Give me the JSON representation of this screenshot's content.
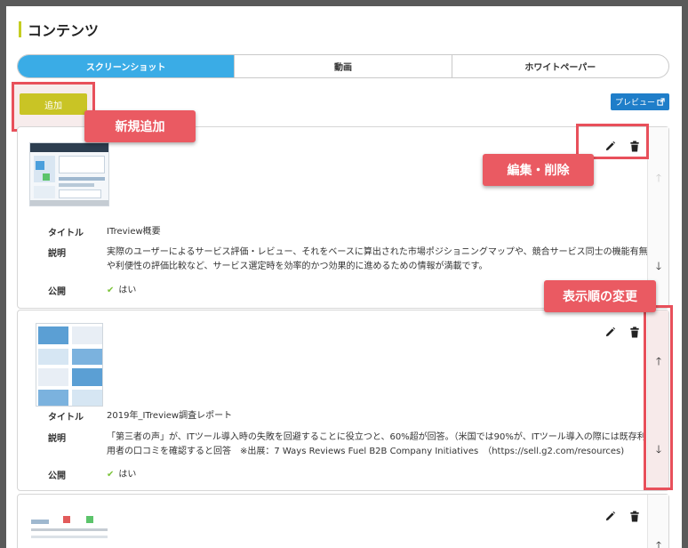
{
  "section": {
    "title": "コンテンツ"
  },
  "tabs": [
    {
      "label": "スクリーンショット",
      "active": true
    },
    {
      "label": "動画",
      "active": false
    },
    {
      "label": "ホワイトペーパー",
      "active": false
    }
  ],
  "toolbar": {
    "add_label": "追加",
    "preview_label": "プレビュー"
  },
  "callouts": {
    "add": "新規追加",
    "edit_delete": "編集・削除",
    "order": "表示順の変更"
  },
  "labels": {
    "title": "タイトル",
    "description": "説明",
    "public": "公開"
  },
  "items": [
    {
      "title": "ITreview概要",
      "description": "実際のユーザーによるサービス評価・レビュー、それをベースに算出された市場ポジショニングマップや、競合サービス同士の機能有無や利便性の評価比較など、サービス選定時を効率的かつ効果的に進めるための情報が満載です。",
      "public": "はい"
    },
    {
      "title": "2019年_ITreview調査レポート",
      "description": "「第三者の声」が、ITツール導入時の失敗を回避することに役立つと、60%超が回答。（米国では90%が、ITツール導入の際には既存利用者の口コミを確認すると回答　※出展：7 Ways Reviews Fuel B2B Company Initiatives　（https://sell.g2.com/resources)",
      "public": "はい"
    }
  ],
  "icons": {
    "edit": "pencil-icon",
    "delete": "trash-icon",
    "up": "arrow-up-icon",
    "down": "arrow-down-icon",
    "check": "check-icon",
    "external": "external-link-icon"
  },
  "colors": {
    "accent": "#3aace6",
    "add_button": "#c9c425",
    "preview_button": "#1f7ec9",
    "highlight": "#e8505b",
    "check": "#7cc43a"
  }
}
